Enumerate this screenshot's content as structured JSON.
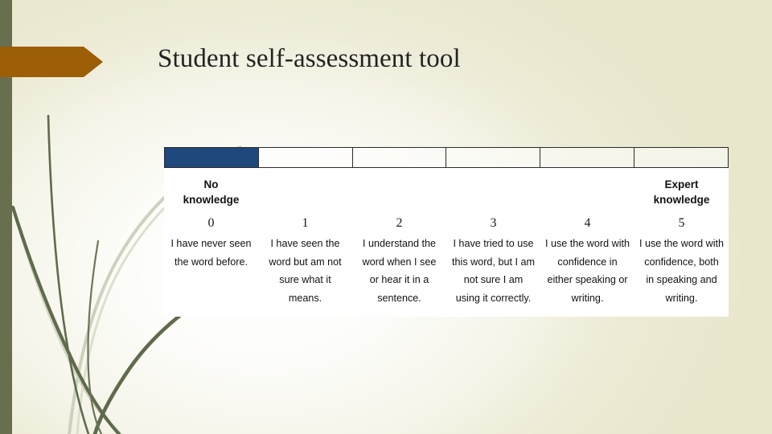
{
  "slide": {
    "title": "Student self-assessment tool",
    "theme": {
      "background_cream": "#e8e6cb",
      "left_band_green": "#676f4e",
      "banner_orange": "#9c5e06",
      "grass_dark_green": "#5f6b4c",
      "grass_light_green": "#c9cdb9",
      "table_header_fill_blue": "#1f497d",
      "table_body_white": "#ffffff",
      "table_border": "#2b2b2b",
      "text_color": "#121212"
    },
    "decorations": {
      "banner_arrow_name": "banner-arrow-shape",
      "left_band_name": "left-accent-band",
      "grass_name": "grass-blades-decoration"
    }
  },
  "table": {
    "header_cells": [
      {
        "filled": true
      },
      {
        "filled": false
      },
      {
        "filled": false
      },
      {
        "filled": false
      },
      {
        "filled": false
      },
      {
        "filled": false
      }
    ],
    "endpoints": {
      "low": "No\nknowledge",
      "low_line1": "No",
      "low_line2": "knowledge",
      "high_line1": "Expert",
      "high_line2": "knowledge"
    },
    "numbers": [
      "0",
      "1",
      "2",
      "3",
      "4",
      "5"
    ],
    "descriptors": [
      "I have never seen the word before.",
      "I have seen the word but am not sure what it means.",
      "I understand the word when I see or hear it in a sentence.",
      "I have tried to use this word, but I am not sure I am using it correctly.",
      "I use the word with confidence in either speaking or writing.",
      "I use the word with confidence, both in speaking and writing."
    ]
  }
}
